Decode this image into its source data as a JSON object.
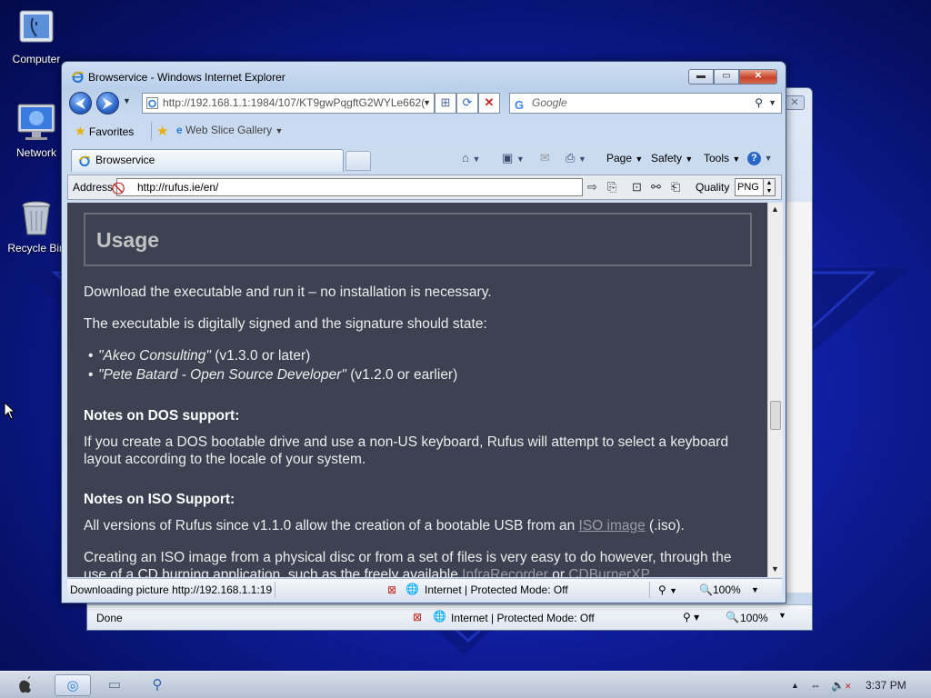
{
  "desktop": {
    "icons": [
      {
        "label": "Computer",
        "icon": "computer-icon"
      },
      {
        "label": "Network",
        "icon": "network-icon"
      },
      {
        "label": "Recycle Bin",
        "icon": "recycle-bin-icon"
      }
    ]
  },
  "back_window": {
    "status_text": "Done",
    "zone_text": "Internet | Protected Mode: Off",
    "zoom": "100%"
  },
  "window": {
    "title": "Browservice - Windows Internet Explorer",
    "url": "http://192.168.1.1:1984/107/KT9gwPqgftG2WYLe662(",
    "search_placeholder": "Google",
    "favorites_label": "Favorites",
    "web_slice_label": "Web Slice Gallery",
    "tab_label": "Browservice",
    "commands": {
      "page": "Page",
      "safety": "Safety",
      "tools": "Tools"
    }
  },
  "plugin_bar": {
    "address_label": "Address",
    "address_value": "http://rufus.ie/en/",
    "quality_label": "Quality",
    "quality_value": "PNG"
  },
  "page": {
    "heading": "Usage",
    "p1": "Download the executable and run it – no installation is necessary.",
    "p2": "The executable is digitally signed and the signature should state:",
    "bullet1_italic": "\"Akeo Consulting\"",
    "bullet1_rest": " (v1.3.0 or later)",
    "bullet2_italic": "\"Pete Batard - Open Source Developer\"",
    "bullet2_rest": " (v1.2.0 or earlier)",
    "dos_heading": "Notes on DOS support:",
    "dos_text": "If you create a DOS bootable drive and use a non-US keyboard, Rufus will attempt to select a keyboard layout according to the locale of your system.",
    "iso_heading": "Notes on ISO Support:",
    "iso_text_pre": "All versions of Rufus since v1.1.0 allow the creation of a bootable USB from an ",
    "iso_link": "ISO image",
    "iso_text_post": " (.iso).",
    "iso_para2_line1": "Creating an ISO image from a physical disc or from a set of files is very easy to do however, through the",
    "iso_para2_line2_pre": "use of a CD burning application, such as the freely available ",
    "iso_para2_link1": "InfraRecorder",
    "iso_para2_mid": " or ",
    "iso_para2_link2": "CDBurnerXP"
  },
  "status_bar": {
    "text": "Downloading picture http://192.168.1.1:19",
    "zone_text": "Internet | Protected Mode: Off",
    "zoom": "100%"
  },
  "taskbar": {
    "clock": "3:37 PM"
  }
}
